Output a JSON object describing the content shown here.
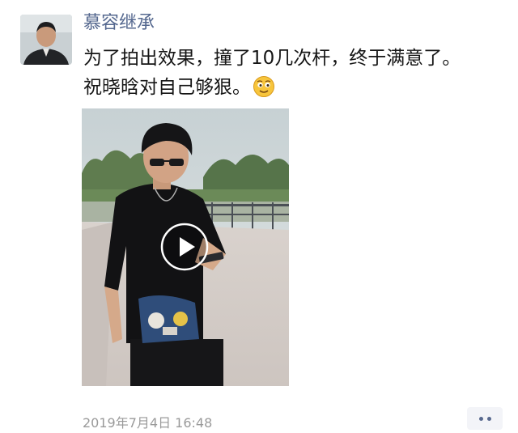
{
  "post": {
    "username": "慕容继承",
    "message_line1": "为了拍出效果，撞了10几次杆，终于满意了。",
    "message_line2": "祝晓晗对自己够狠。",
    "emoji": "smiling-face-emoji",
    "timestamp": "2019年7月4日 16:48"
  },
  "video": {
    "play_icon": "play-icon"
  },
  "actions": {
    "more_icon": "more-dots-icon"
  },
  "colors": {
    "username": "#55688f",
    "timestamp": "#9a9a9a",
    "more_button_bg": "#f3f4f8"
  }
}
